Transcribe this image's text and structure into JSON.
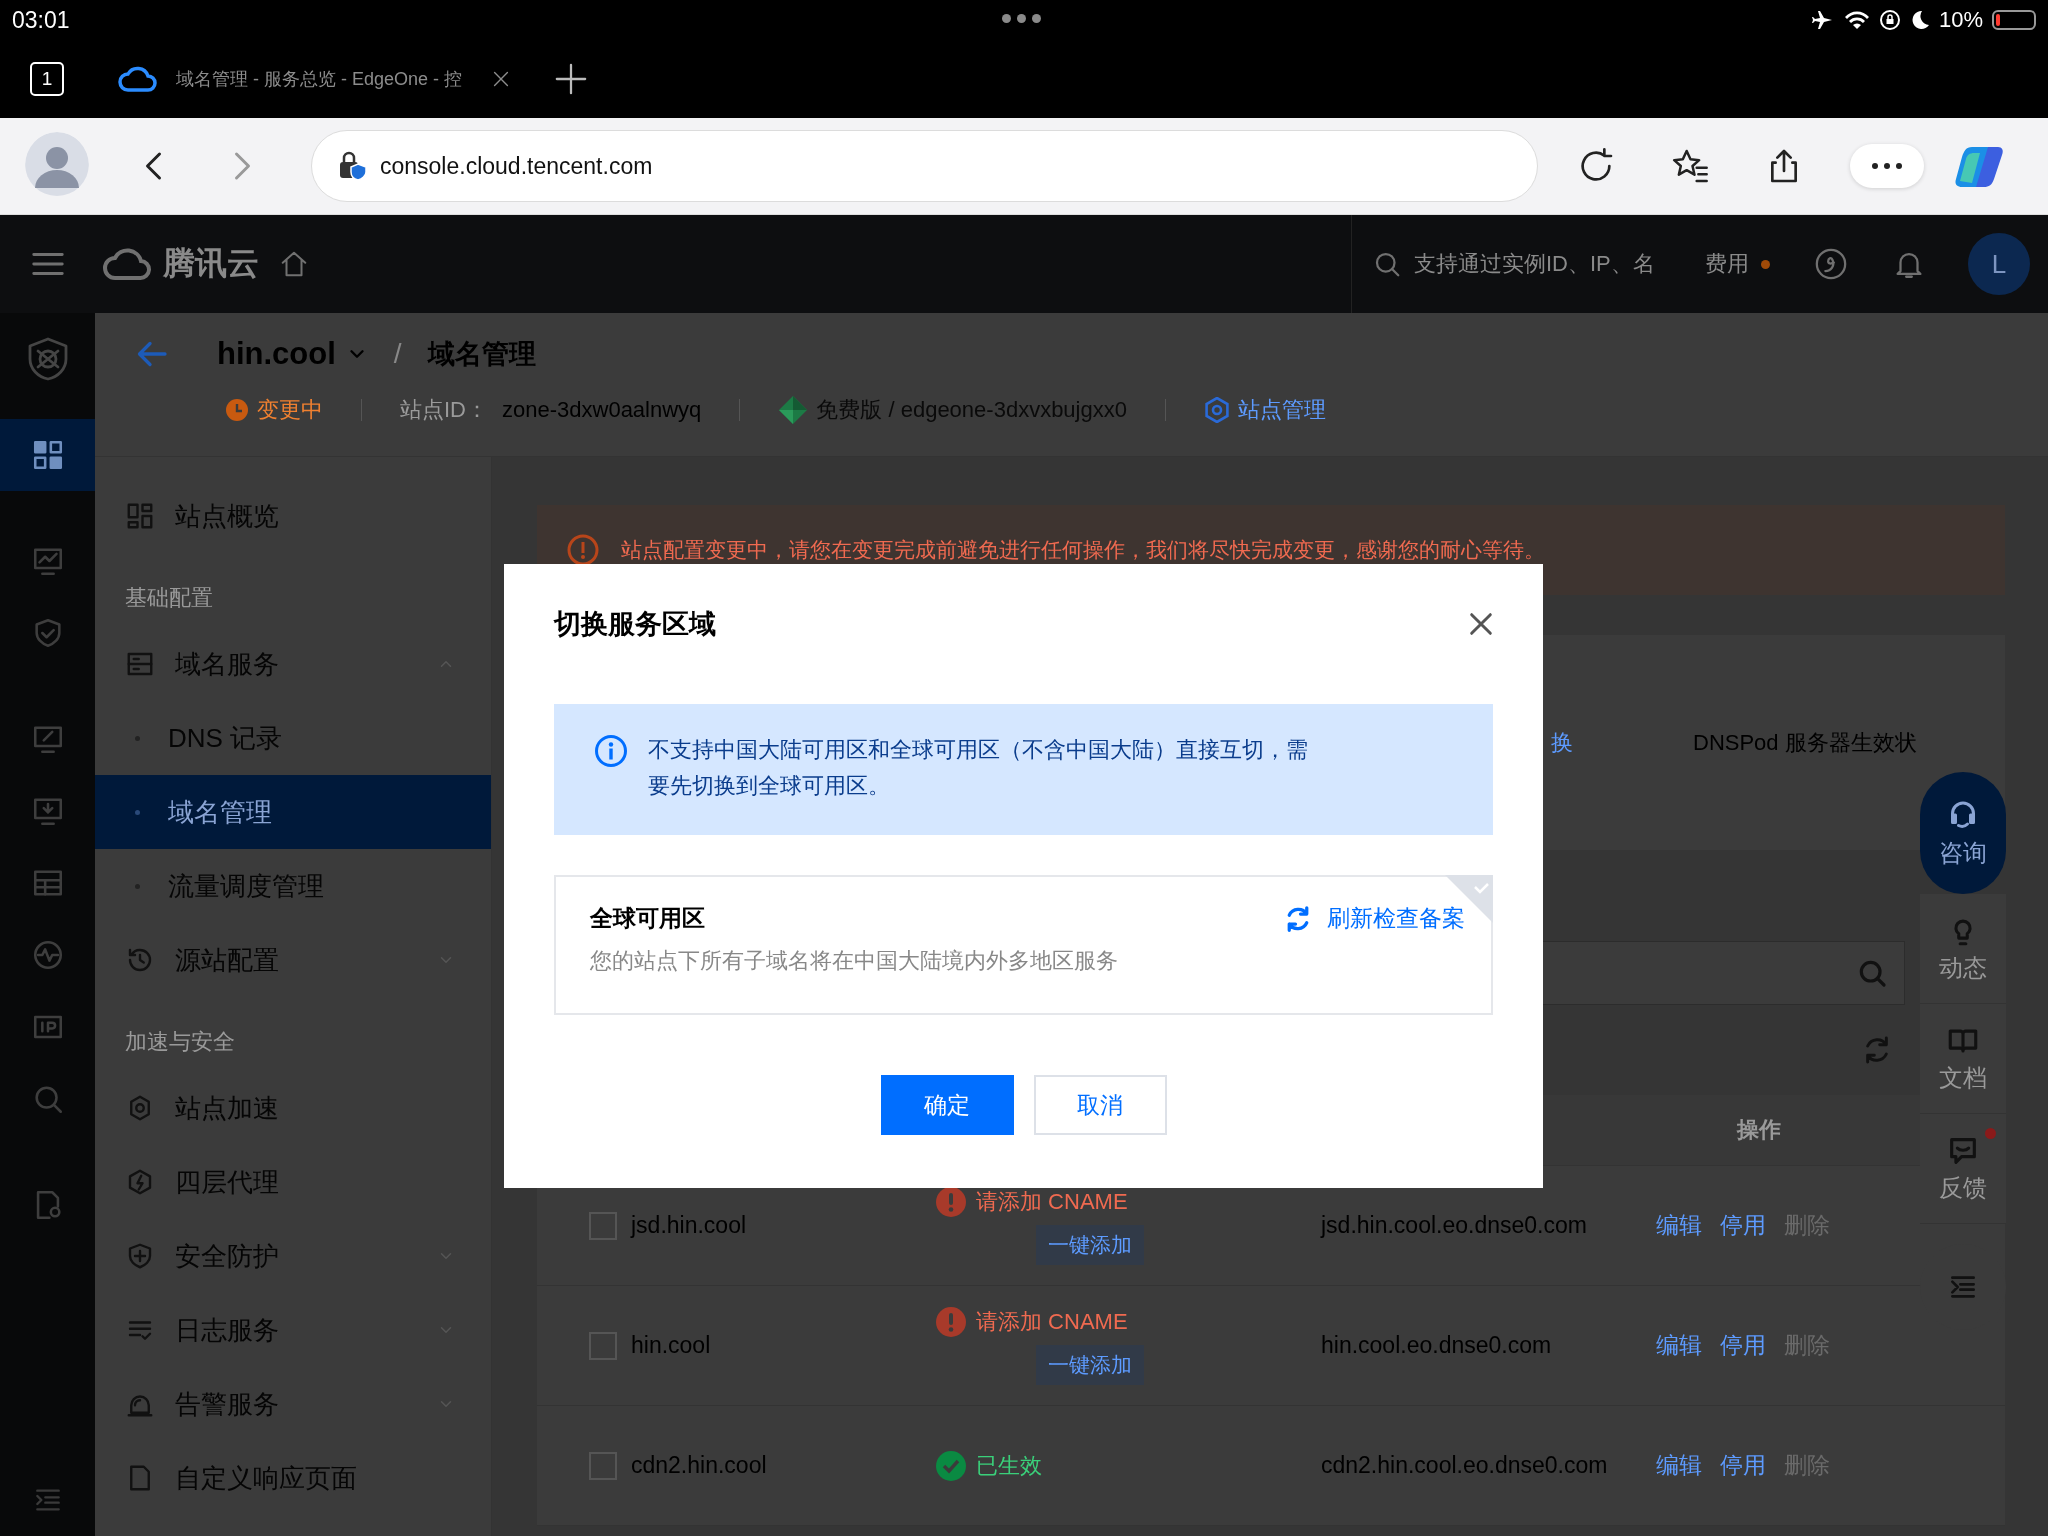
{
  "status_bar": {
    "time": "03:01",
    "battery": "10%"
  },
  "browser": {
    "tab_count": "1",
    "tab_title": "域名管理 - 服务总览 - EdgeOne - 控",
    "url": "console.cloud.tencent.com"
  },
  "top_nav": {
    "brand": "腾讯云",
    "search_placeholder": "支持通过实例ID、IP、名",
    "billing": "费用",
    "avatar": "L"
  },
  "rail": [
    {
      "selected": true
    },
    {
      "selected": false
    },
    {
      "selected": false
    },
    {
      "selected": false
    },
    {
      "selected": false
    },
    {
      "selected": false
    },
    {
      "selected": false
    },
    {
      "selected": false
    },
    {
      "selected": false
    },
    {
      "selected": false
    }
  ],
  "breadcrumb": {
    "site": "hin.cool",
    "separator": "/",
    "page": "域名管理"
  },
  "site_info": {
    "status": "变更中",
    "id_label": "站点ID：",
    "id": "zone-3dxw0aalnwyq",
    "plan": "免费版 / edgeone-3dxvxbujgxx0",
    "manage": "站点管理"
  },
  "sidebar": [
    {
      "kind": "item",
      "label": "站点概览",
      "selected": false
    },
    {
      "kind": "section",
      "label": "基础配置"
    },
    {
      "kind": "item",
      "label": "域名服务",
      "selected": false,
      "expanded": true
    },
    {
      "kind": "subitem",
      "label": "DNS 记录",
      "selected": false
    },
    {
      "kind": "subitem",
      "label": "域名管理",
      "selected": true
    },
    {
      "kind": "subitem",
      "label": "流量调度管理",
      "selected": false
    },
    {
      "kind": "item",
      "label": "源站配置",
      "selected": false,
      "expanded": false
    },
    {
      "kind": "section",
      "label": "加速与安全"
    },
    {
      "kind": "item",
      "label": "站点加速",
      "selected": false
    },
    {
      "kind": "item",
      "label": "四层代理",
      "selected": false
    },
    {
      "kind": "item",
      "label": "安全防护",
      "selected": false,
      "expanded": false
    },
    {
      "kind": "item",
      "label": "日志服务",
      "selected": false,
      "expanded": false
    },
    {
      "kind": "item",
      "label": "告警服务",
      "selected": false,
      "expanded": false
    },
    {
      "kind": "item",
      "label": "自定义响应页面",
      "selected": false
    }
  ],
  "notice": "站点配置变更中，请您在变更完成前避免进行任何操作，我们将尽快完成变更，感谢您的耐心等待。",
  "card": {
    "link": "换",
    "label": "DNSPod 服务器生效状"
  },
  "table": {
    "columns": [
      "操作"
    ],
    "rows": [
      {
        "checked": false,
        "domain": "jsd.hin.cool",
        "kind": "warning",
        "status": "请添加 CNAME",
        "action": "一键添加",
        "cname": "jsd.hin.cool.eo.dnse0.com",
        "ops": [
          {
            "label": "编辑",
            "disabled": false
          },
          {
            "label": "停用",
            "disabled": false
          },
          {
            "label": "删除",
            "disabled": true
          }
        ]
      },
      {
        "checked": false,
        "domain": "hin.cool",
        "kind": "warning",
        "status": "请添加 CNAME",
        "action": "一键添加",
        "cname": "hin.cool.eo.dnse0.com",
        "ops": [
          {
            "label": "编辑",
            "disabled": false
          },
          {
            "label": "停用",
            "disabled": false
          },
          {
            "label": "删除",
            "disabled": true
          }
        ]
      },
      {
        "checked": false,
        "domain": "cdn2.hin.cool",
        "kind": "ok",
        "status": "已生效",
        "cname": "cdn2.hin.cool.eo.dnse0.com",
        "ops": [
          {
            "label": "编辑",
            "disabled": false
          },
          {
            "label": "停用",
            "disabled": false
          },
          {
            "label": "删除",
            "disabled": true
          }
        ]
      }
    ]
  },
  "float_tools": [
    {
      "label": "咨询",
      "kind": "primary",
      "badge": false
    },
    {
      "label": "动态",
      "kind": "plain",
      "badge": false
    },
    {
      "label": "文档",
      "kind": "plain",
      "badge": false
    },
    {
      "label": "反馈",
      "kind": "plain",
      "badge": true
    }
  ],
  "dialog": {
    "title": "切换服务区域",
    "info": "不支持中国大陆可用区和全球可用区（不含中国大陆）直接互切，需要先切换到全球可用区。",
    "option": {
      "title": "全球可用区",
      "description": "您的站点下所有子域名将在中国大陆境内外多地区服务",
      "link": "刷新检查备案",
      "selected": true
    },
    "buttons": [
      {
        "label": "确定",
        "kind": "primary"
      },
      {
        "label": "取消",
        "kind": "secondary"
      }
    ]
  }
}
